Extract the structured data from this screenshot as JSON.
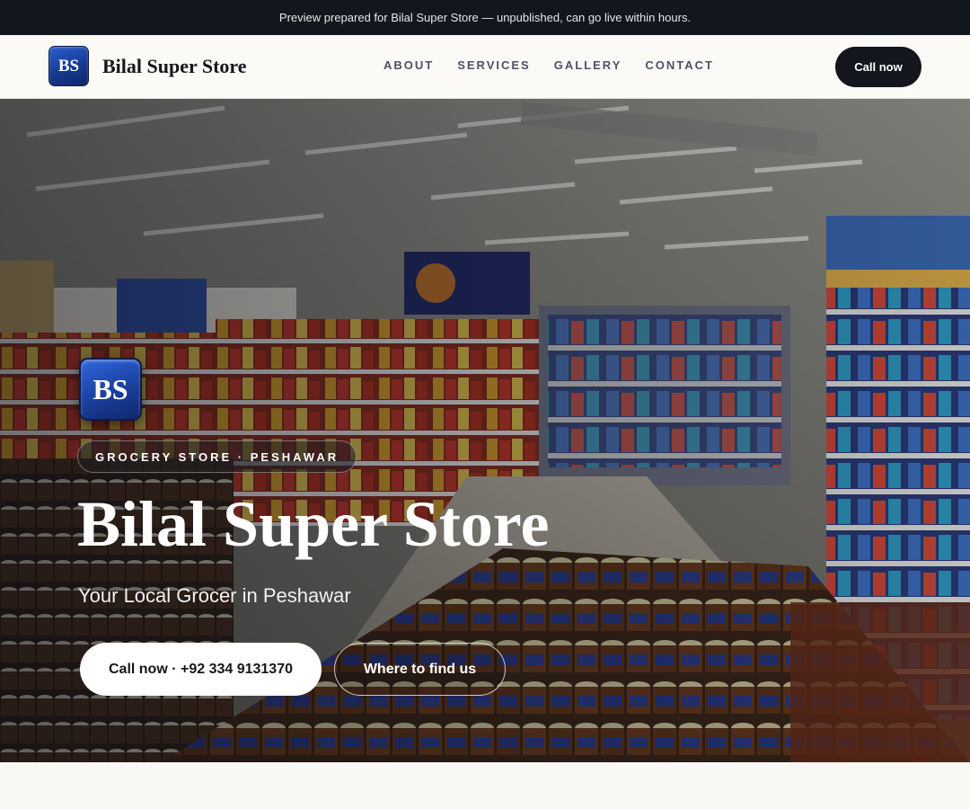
{
  "announcement": "Preview prepared for Bilal Super Store — unpublished, can go live within hours.",
  "brand": {
    "logo_text": "BS",
    "name": "Bilal Super Store"
  },
  "nav": {
    "items": [
      {
        "label": "ABOUT"
      },
      {
        "label": "SERVICES"
      },
      {
        "label": "GALLERY"
      },
      {
        "label": "CONTACT"
      }
    ],
    "call_label": "Call now"
  },
  "hero": {
    "logo_text": "BS",
    "tag": "GROCERY STORE · PESHAWAR",
    "title": "Bilal Super Store",
    "subtitle": "Your Local Grocer in Peshawar",
    "primary_cta": "Call now · +92 334 9131370",
    "secondary_cta": "Where to find us"
  },
  "colors": {
    "topbar_bg": "#12161d",
    "call_button_bg": "#13161c",
    "logo_blue": "#1a3f9e",
    "page_bg": "#f9f8f5"
  },
  "icons": {
    "hero_background": "grocery-store-aisle-image"
  }
}
